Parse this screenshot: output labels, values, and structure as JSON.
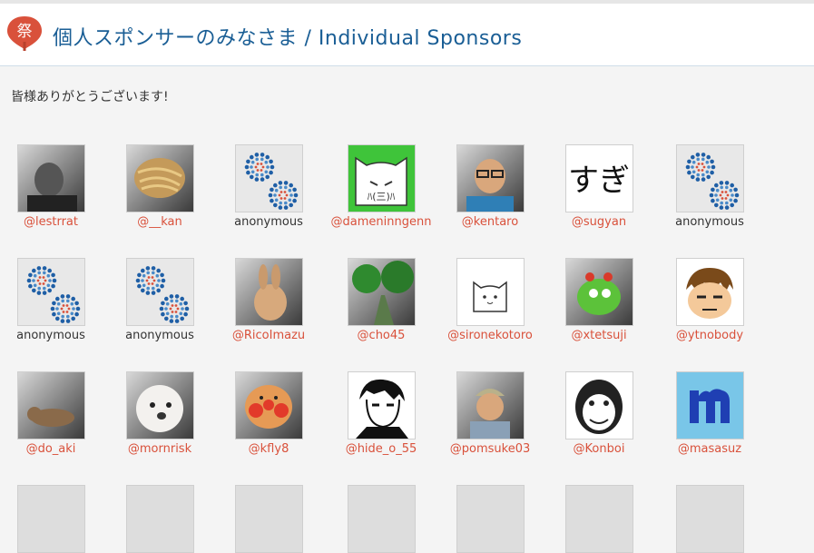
{
  "header": {
    "title": "個人スポンサーのみなさま / Individual Sponsors",
    "logo_char": "祭",
    "accent": "#d9513b",
    "title_color": "#1a5e95"
  },
  "thanks": "皆様ありがとうございます!",
  "sponsors": [
    {
      "name": "@lestrrat",
      "icon": "photo-man-icon",
      "anon": false
    },
    {
      "name": "@__kan",
      "icon": "noodles-photo-icon",
      "anon": false
    },
    {
      "name": "anonymous",
      "icon": "dot-pattern-icon",
      "anon": true
    },
    {
      "name": "@dameninngenn",
      "icon": "cat-face-drawing-icon",
      "anon": false
    },
    {
      "name": "@kentaro",
      "icon": "photo-glasses-man-icon",
      "anon": false
    },
    {
      "name": "@sugyan",
      "icon": "hiragana-sugi-icon",
      "anon": false
    },
    {
      "name": "anonymous",
      "icon": "dot-pattern-icon",
      "anon": true
    },
    {
      "name": "anonymous",
      "icon": "dot-pattern-icon",
      "anon": true
    },
    {
      "name": "anonymous",
      "icon": "dot-pattern-icon",
      "anon": true
    },
    {
      "name": "@RicoImazu",
      "icon": "rabbit-photo-icon",
      "anon": false
    },
    {
      "name": "@cho45",
      "icon": "forest-path-photo-icon",
      "anon": false
    },
    {
      "name": "@sironekotoro",
      "icon": "white-cat-drawing-icon",
      "anon": false
    },
    {
      "name": "@xtetsuji",
      "icon": "green-frog-toy-icon",
      "anon": false
    },
    {
      "name": "@ytnobody",
      "icon": "cartoon-face-icon",
      "anon": false
    },
    {
      "name": "@do_aki",
      "icon": "cat-on-grass-photo-icon",
      "anon": false
    },
    {
      "name": "@mornrisk",
      "icon": "white-dog-photo-icon",
      "anon": false
    },
    {
      "name": "@kfly8",
      "icon": "anpanman-icon",
      "anon": false
    },
    {
      "name": "@hide_o_55",
      "icon": "bw-portrait-icon",
      "anon": false
    },
    {
      "name": "@pomsuke03",
      "icon": "photo-cap-man-icon",
      "anon": false
    },
    {
      "name": "@Konboi",
      "icon": "gorilla-drawing-icon",
      "anon": false
    },
    {
      "name": "@masasuz",
      "icon": "letter-m-icon",
      "anon": false
    }
  ]
}
